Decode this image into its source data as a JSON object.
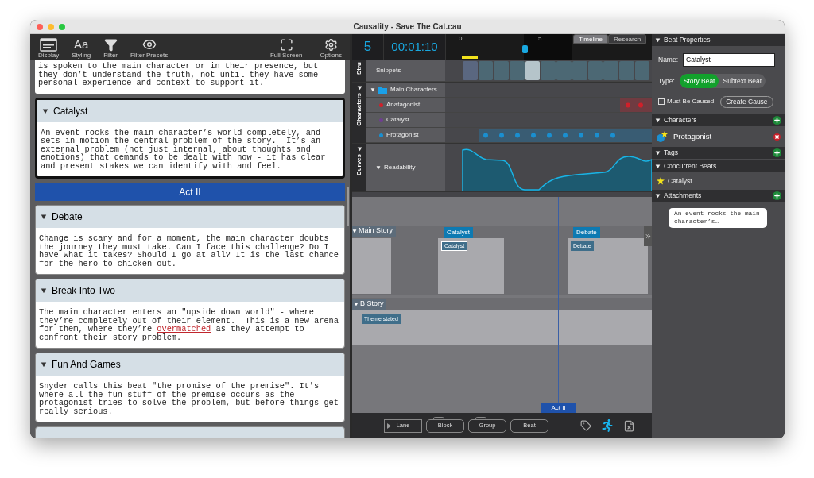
{
  "window": {
    "title": "Causality - Save The Cat.cau"
  },
  "toolbar": {
    "left": [
      {
        "label": "Display"
      },
      {
        "label": "Styling",
        "glyph": "Aa"
      },
      {
        "label": "Filter"
      },
      {
        "label": "Filter Presets"
      }
    ],
    "right": [
      {
        "label": "Full Screen"
      },
      {
        "label": "Options"
      }
    ]
  },
  "beat_list": [
    {
      "kind": "partial",
      "segments": [
        {
          "text": "is spoken to the main character or in their presence, but they don’t understand the truth, not until they have some personal experience and context to support it.",
          "misspelled": false
        }
      ]
    },
    {
      "kind": "beat",
      "title": "Catalyst",
      "selected": true,
      "segments": [
        {
          "text": "An event rocks the main character’s world completely, and sets in motion the central problem of the story.  It’s an external problem (not just internal, about thoughts and emotions) that demands to be dealt with now - it has clear and present stakes we can identify with and feel.",
          "misspelled": false
        }
      ]
    },
    {
      "kind": "act",
      "label": "Act II"
    },
    {
      "kind": "beat",
      "title": "Debate",
      "selected": false,
      "segments": [
        {
          "text": "Change is scary and for a moment, the main character doubts the journey they must take. Can I face this challenge? Do I have what it takes? Should I go at all? It is the last chance for the hero to chicken out.",
          "misspelled": false
        }
      ]
    },
    {
      "kind": "beat",
      "title": "Break Into Two",
      "selected": false,
      "segments": [
        {
          "text": "The main character enters an \"upside down world\" - where they’re completely out of their element.  This is a new arena for them, where they’re ",
          "misspelled": false
        },
        {
          "text": "overmatched",
          "misspelled": true
        },
        {
          "text": " as they attempt to confront their story problem.",
          "misspelled": false
        }
      ]
    },
    {
      "kind": "beat",
      "title": "Fun And Games",
      "selected": false,
      "segments": [
        {
          "text": "Snyder calls this beat \"the promise of the premise\". It's where all the fun stuff of the premise occurs as the protagonist tries to solve the problem, but before things get really serious.",
          "misspelled": false
        }
      ]
    },
    {
      "kind": "stub"
    }
  ],
  "timeline": {
    "count": "5",
    "time": "00:01:10",
    "ruler_labels": [
      "0",
      "5"
    ],
    "tabs": [
      {
        "label": "Timeline",
        "selected": true
      },
      {
        "label": "Research",
        "selected": false
      }
    ],
    "snippets": [
      {
        "selected": false
      },
      {
        "selected": false
      },
      {
        "selected": false
      },
      {
        "selected": false
      },
      {
        "selected": true
      },
      {
        "selected": false
      },
      {
        "selected": false
      },
      {
        "selected": false
      },
      {
        "selected": false
      },
      {
        "selected": false
      },
      {
        "selected": false
      },
      {
        "selected": false
      }
    ],
    "sections": [
      {
        "label": "Stru",
        "rows": [
          {
            "kind": "snippets",
            "label": "Snippets"
          }
        ]
      },
      {
        "label": "Characters",
        "expanded": true,
        "rows": [
          {
            "kind": "group",
            "label": "Main Characters",
            "expanded": true
          },
          {
            "kind": "character",
            "label": "Anatagonist",
            "color": "#d0202a"
          },
          {
            "kind": "character",
            "label": "Catalyst",
            "color": "#6e3f8f"
          },
          {
            "kind": "character",
            "label": "Protagonist",
            "color": "#1a8fd0"
          }
        ]
      },
      {
        "label": "Curves",
        "expanded": true,
        "rows": [
          {
            "kind": "curve",
            "label": "Readability",
            "expanded": true
          }
        ]
      }
    ]
  },
  "storyboard": {
    "lanes": [
      {
        "label": "Main Story",
        "expanded": true,
        "blocks": [
          {
            "kind": "block"
          },
          {
            "kind": "block",
            "title": "Catalyst",
            "beats": [
              {
                "label": "Catalyst",
                "selected": true
              }
            ]
          },
          {
            "kind": "block",
            "title": "Debate",
            "beats": [
              {
                "label": "Debate",
                "selected": false
              }
            ]
          }
        ]
      },
      {
        "label": "B Story",
        "expanded": true,
        "beats": [
          {
            "label": "Theme stated",
            "selected": false
          }
        ]
      }
    ],
    "act_marker": "Act II"
  },
  "bottom_toolbar": {
    "buttons": [
      {
        "label": "Lane",
        "kind": "lane"
      },
      {
        "label": "Block",
        "kind": "folder"
      },
      {
        "label": "Group",
        "kind": "folder"
      },
      {
        "label": "Beat",
        "kind": "plain"
      }
    ],
    "tools": [
      {
        "active": false
      },
      {
        "active": true
      },
      {
        "active": false
      }
    ]
  },
  "beat_properties": {
    "title": "Beat Properties",
    "name_label": "Name:",
    "name_value": "Catalyst",
    "type_label": "Type:",
    "types": [
      {
        "label": "Story Beat",
        "selected": true
      },
      {
        "label": "Subtext Beat",
        "selected": false
      }
    ],
    "must_be_caused": {
      "label": "Must Be Caused",
      "checked": false
    },
    "create_cause": "Create Cause"
  },
  "characters": {
    "title": "Characters",
    "items": [
      {
        "label": "Protagonist"
      }
    ]
  },
  "tags": {
    "title": "Tags"
  },
  "concurrent_beats": {
    "title": "Concurrent Beats",
    "items": [
      {
        "label": "Catalyst"
      }
    ]
  },
  "attachments": {
    "title": "Attachments",
    "items": [
      {
        "text": "An event rocks the main character’s…"
      }
    ]
  }
}
